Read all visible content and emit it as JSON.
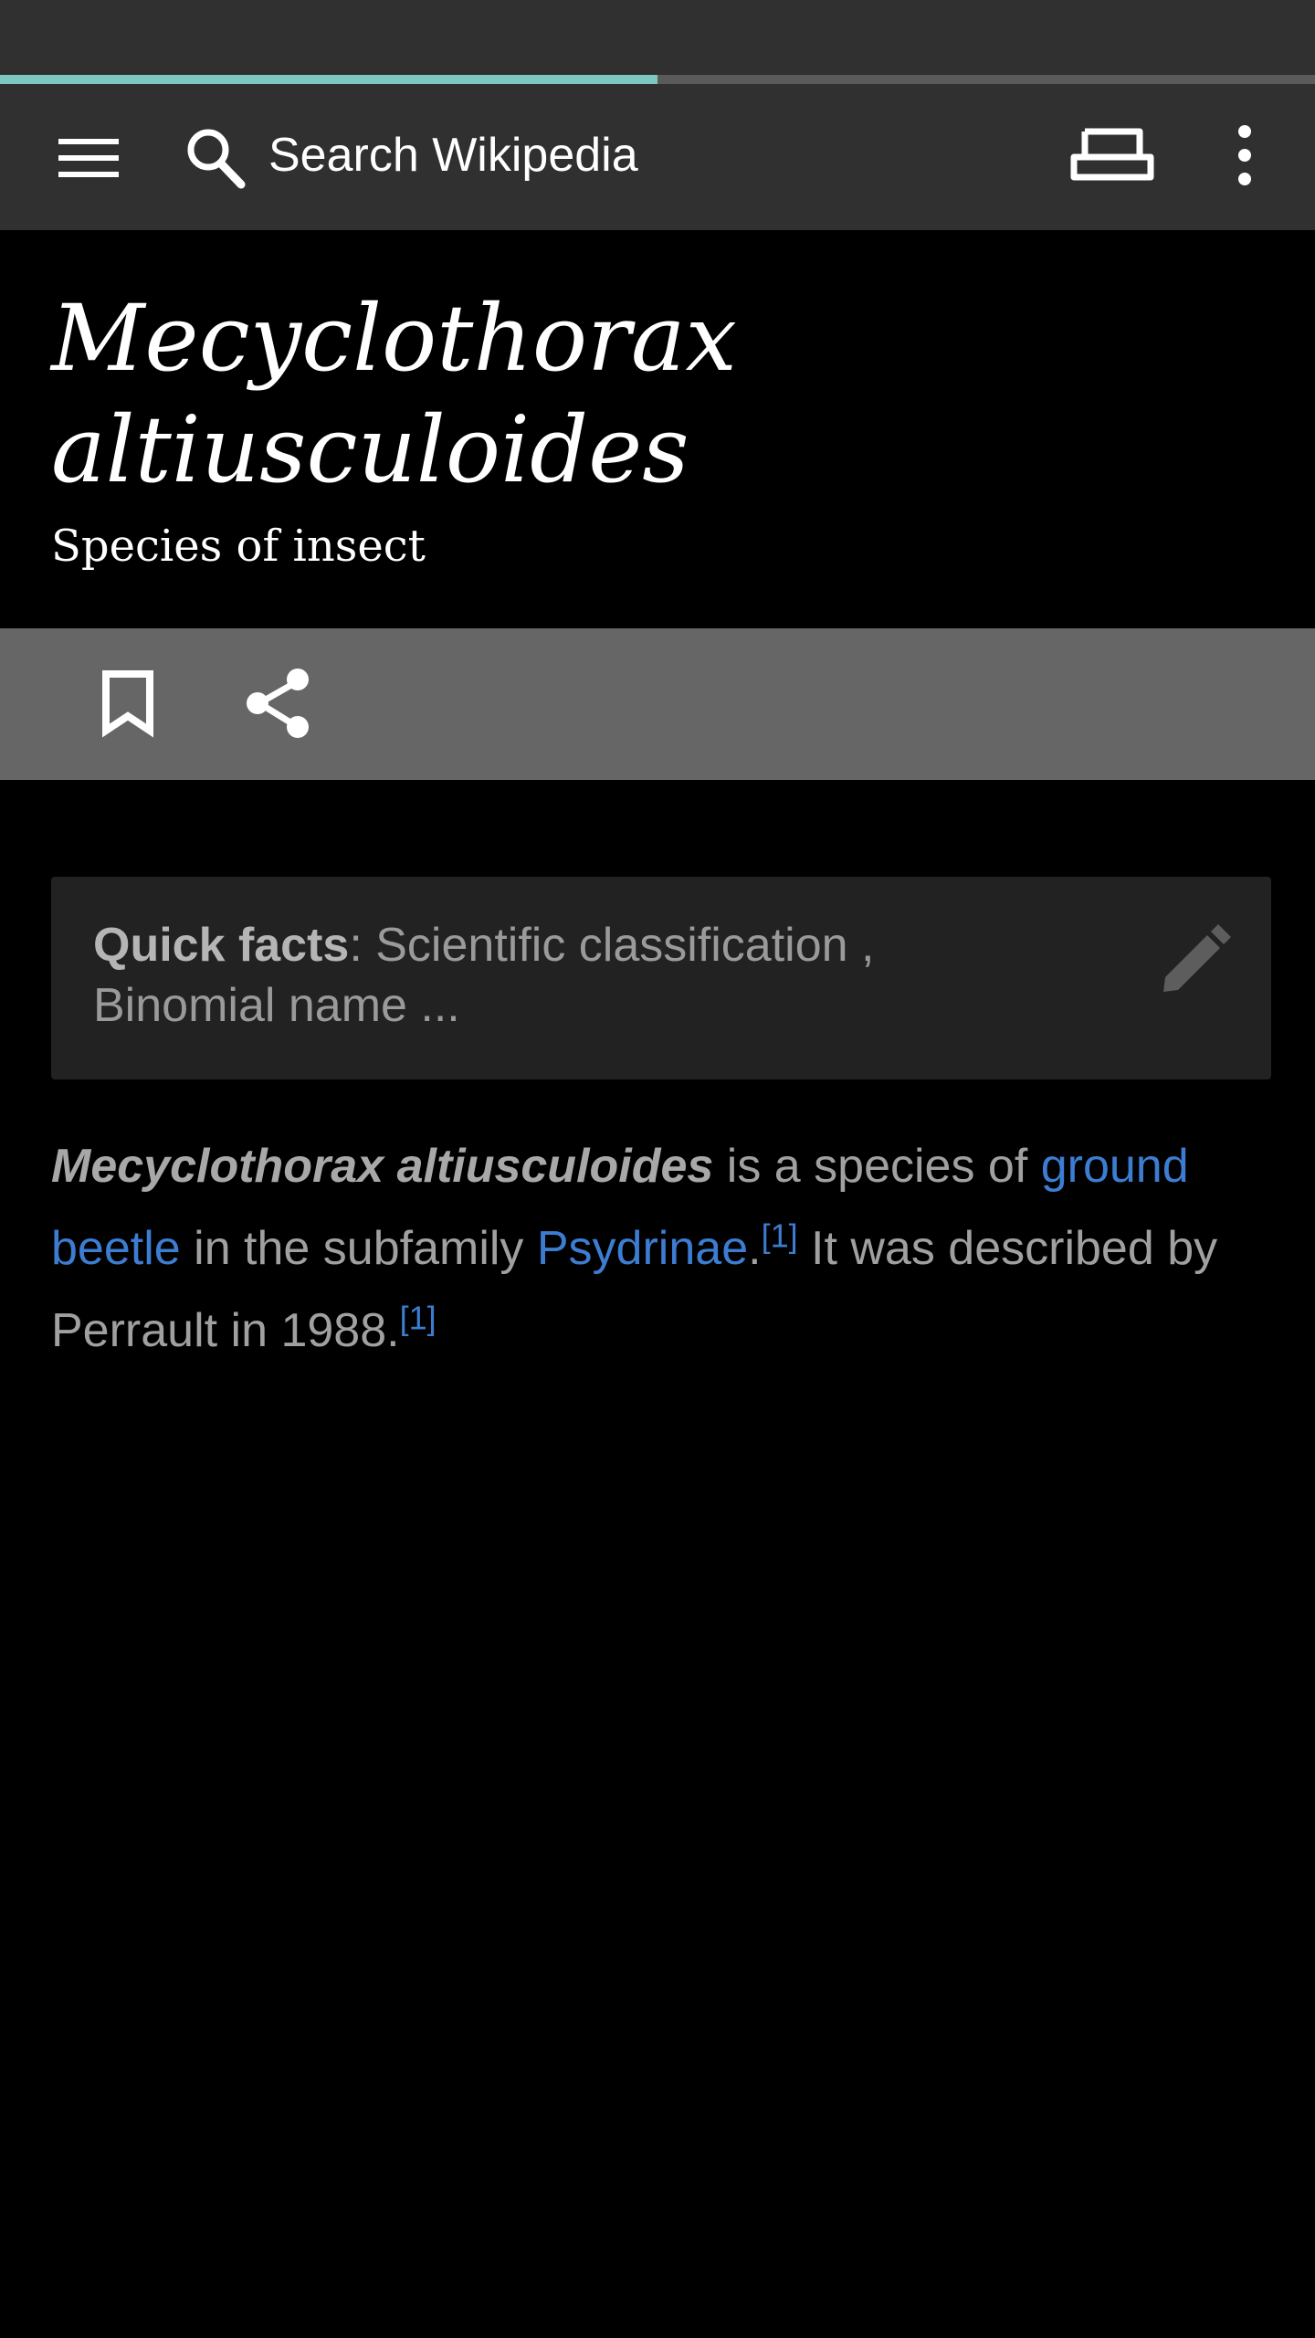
{
  "status_bar": {},
  "page_load_progress": 0.5,
  "toolbar": {
    "search_placeholder": "Search Wikipedia",
    "icons": [
      "menu-icon",
      "search-icon",
      "tabs-icon",
      "overflow-menu-icon"
    ]
  },
  "article": {
    "title": "Mecyclothorax altiusculoides",
    "description": "Species of insect"
  },
  "actions": {
    "icons": [
      "bookmark-icon",
      "share-icon"
    ]
  },
  "quick_facts": {
    "label": "Quick facts",
    "text": ": Scientific classification , Binomial name ..."
  },
  "body": {
    "sci_name": "Mecyclothorax altiusculoides",
    "text_1": " is a species of ",
    "link_ground_beetle": "ground beetle",
    "text_2": " in the subfamily ",
    "link_psydrinae": "Psydrinae",
    "text_3": ".",
    "ref_1": "[1]",
    "text_4": " It was described by Perrault in 1988.",
    "ref_2": "[1]"
  },
  "colors": {
    "toolbar_bg": "#303030",
    "progress_fill": "#7ec8c3",
    "action_bar_bg": "#666666",
    "link": "#3d7dd1",
    "quick_facts_bg": "#222222"
  }
}
